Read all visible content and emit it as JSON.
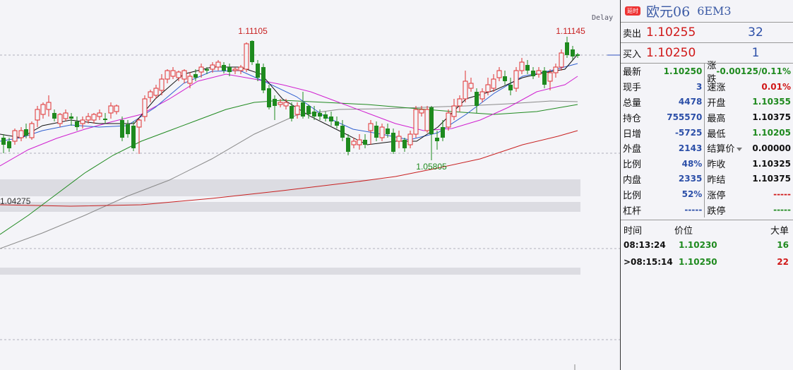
{
  "header": {
    "badge": "延时",
    "title": "欧元06",
    "code": "6EM3",
    "delay": "Delay"
  },
  "quote": {
    "ask_label": "卖出",
    "ask_price": "1.10255",
    "ask_vol": "32",
    "bid_label": "买入",
    "bid_price": "1.10250",
    "bid_vol": "1"
  },
  "stats_left": [
    {
      "label": "最新",
      "value": "1.10250",
      "color": "green"
    },
    {
      "label": "现手",
      "value": "3",
      "color": "blue"
    },
    {
      "label": "总量",
      "value": "4478",
      "color": "blue"
    },
    {
      "label": "持仓",
      "value": "755570",
      "color": "blue"
    },
    {
      "label": "日增",
      "value": "-5725",
      "color": "blue"
    },
    {
      "label": "外盘",
      "value": "2143",
      "color": "blue"
    },
    {
      "label": "比例",
      "value": "48%",
      "color": "blue"
    },
    {
      "label": "内盘",
      "value": "2335",
      "color": "blue"
    },
    {
      "label": "比例",
      "value": "52%",
      "color": "blue"
    },
    {
      "label": "杠杆",
      "value": "-----",
      "color": "blue"
    }
  ],
  "stats_right": [
    {
      "label": "涨跌",
      "value": "-0.00125/0.11%",
      "color": "green"
    },
    {
      "label": "速涨",
      "value": "0.01%",
      "color": "red"
    },
    {
      "label": "开盘",
      "value": "1.10355",
      "color": "green"
    },
    {
      "label": "最高",
      "value": "1.10375",
      "color": "black"
    },
    {
      "label": "最低",
      "value": "1.10205",
      "color": "green"
    },
    {
      "label": "结算价",
      "value": "0.00000",
      "color": "black"
    },
    {
      "label": "昨收",
      "value": "1.10325",
      "color": "black"
    },
    {
      "label": "昨结",
      "value": "1.10375",
      "color": "black"
    },
    {
      "label": "涨停",
      "value": "-----",
      "color": "red"
    },
    {
      "label": "跌停",
      "value": "-----",
      "color": "green"
    }
  ],
  "ticks": {
    "headers": [
      "时间",
      "价位",
      "大单"
    ],
    "rows": [
      {
        "time": "08:13:24",
        "price": "1.10230",
        "vol": "16",
        "vol_color": "green"
      },
      {
        "time": ">08:15:14",
        "price": "1.10250",
        "vol": "22",
        "vol_color": "red"
      }
    ]
  },
  "chart_data": {
    "type": "candlestick",
    "annotations": {
      "high_1": "1.11105",
      "high_2": "1.11145",
      "low": "1.05805",
      "level": "1.04275"
    },
    "colors": {
      "up": "#e03030",
      "down": "#1e8a1e",
      "ma5": "#111111",
      "ma10": "#3060d0",
      "ma20": "#d020d0",
      "ma40": "#208a20",
      "ma60": "#8a8a8a",
      "ma120": "#c82020"
    }
  }
}
